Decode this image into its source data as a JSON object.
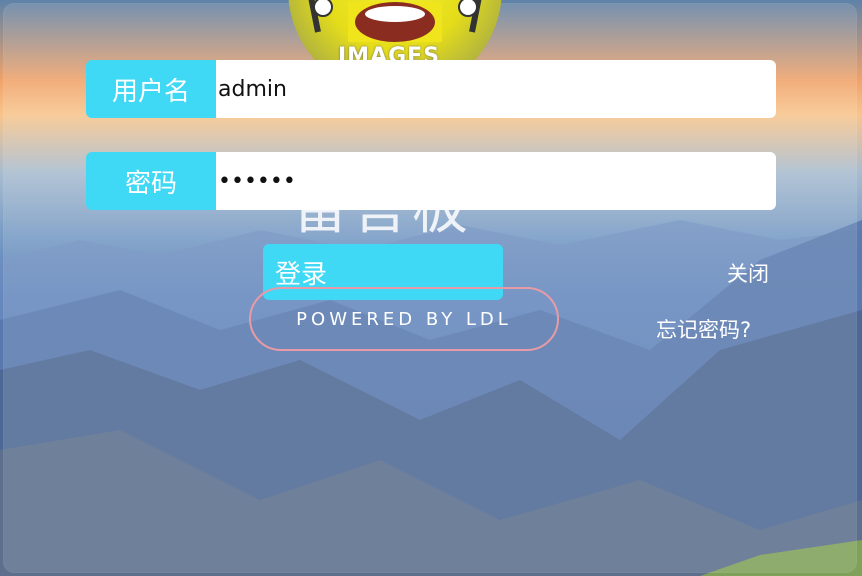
{
  "avatar": {
    "watermark_text": "IMAGES"
  },
  "background": {
    "title_fragment": "留言板"
  },
  "form": {
    "username": {
      "label": "用户名",
      "value": "admin"
    },
    "password": {
      "label": "密码",
      "value": "••••••"
    },
    "login_label": "登录",
    "powered_by": "POWERED BY LDL",
    "close_label": "关闭",
    "forgot_label": "忘记密码?"
  },
  "colors": {
    "accent": "#3fd8f5",
    "pill_border": "#e89ba6",
    "text_light": "#ffffff"
  }
}
